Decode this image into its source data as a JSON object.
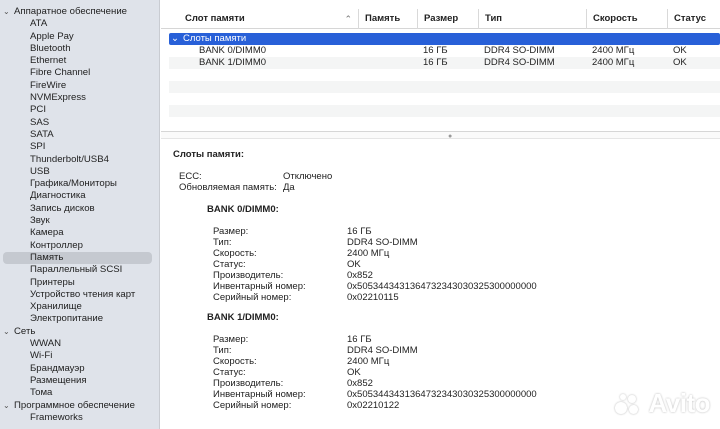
{
  "sidebar": {
    "hardware": {
      "label": "Аппаратное обеспечение",
      "items": [
        "ATA",
        "Apple Pay",
        "Bluetooth",
        "Ethernet",
        "Fibre Channel",
        "FireWire",
        "NVMExpress",
        "PCI",
        "SAS",
        "SATA",
        "SPI",
        "Thunderbolt/USB4",
        "USB",
        "Графика/Мониторы",
        "Диагностика",
        "Запись дисков",
        "Звук",
        "Камера",
        "Контроллер",
        "Память",
        "Параллельный SCSI",
        "Принтеры",
        "Устройство чтения карт",
        "Хранилище",
        "Электропитание"
      ],
      "selected": "Память"
    },
    "network": {
      "label": "Сеть",
      "items": [
        "WWAN",
        "Wi-Fi",
        "Брандмауэр",
        "Размещения",
        "Тома"
      ]
    },
    "software": {
      "label": "Программное обеспечение",
      "items": [
        "Frameworks"
      ]
    }
  },
  "table": {
    "columns": {
      "slot": "Слот памяти",
      "memory": "Память",
      "size": "Размер",
      "type": "Тип",
      "speed": "Скорость",
      "status": "Статус"
    },
    "group_label": "Слоты памяти",
    "rows": [
      {
        "slot": "BANK 0/DIMM0",
        "size": "16 ГБ",
        "type": "DDR4 SO-DIMM",
        "speed": "2400 МГц",
        "status": "OK"
      },
      {
        "slot": "BANK 1/DIMM0",
        "size": "16 ГБ",
        "type": "DDR4 SO-DIMM",
        "speed": "2400 МГц",
        "status": "OK"
      }
    ]
  },
  "detail": {
    "title": "Слоты памяти:",
    "ecc_label": "ECC:",
    "ecc_value": "Отключено",
    "upgradeable_label": "Обновляемая память:",
    "upgradeable_value": "Да",
    "labels": {
      "size": "Размер:",
      "type": "Тип:",
      "speed": "Скорость:",
      "status": "Статус:",
      "manufacturer": "Производитель:",
      "part_number": "Инвентарный номер:",
      "serial": "Серийный номер:"
    },
    "banks": [
      {
        "title": "BANK 0/DIMM0:",
        "size": "16 ГБ",
        "type": "DDR4 SO-DIMM",
        "speed": "2400 МГц",
        "status": "OK",
        "manufacturer": "0x852",
        "part_number": "0x5053443431364732343030325300000000",
        "serial": "0x02210115"
      },
      {
        "title": "BANK 1/DIMM0:",
        "size": "16 ГБ",
        "type": "DDR4 SO-DIMM",
        "speed": "2400 МГц",
        "status": "OK",
        "manufacturer": "0x852",
        "part_number": "0x5053443431364732343030325300000000",
        "serial": "0x02210122"
      }
    ]
  },
  "watermark": {
    "text": "Avito"
  },
  "icons": {
    "expand": "chevron-down-icon",
    "sort": "chevron-up-icon",
    "grip": "splitter-grip-icon"
  },
  "colors": {
    "selection": "#2860d8",
    "sidebar_bg": "#dfe3ea",
    "sidebar_selected": "#c5c9d0"
  }
}
